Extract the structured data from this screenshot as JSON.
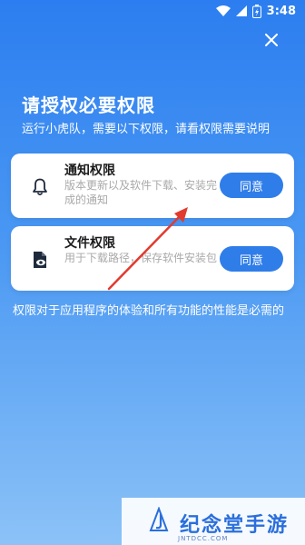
{
  "status_bar": {
    "time": "3:48"
  },
  "header": {
    "title": "请授权必要权限",
    "subtitle": "运行小虎队，需要以下权限，请看权限需要说明"
  },
  "permissions": [
    {
      "icon": "bell-icon",
      "title": "通知权限",
      "description": "版本更新以及软件下载、安装完成的通知",
      "button": "同意"
    },
    {
      "icon": "file-view-icon",
      "title": "文件权限",
      "description": "用于下载路径，保存软件安装包",
      "button": "同意"
    }
  ],
  "footer_note": "权限对于应用程序的体验和所有功能的性能是必需的",
  "watermark": {
    "text": "纪念堂手游",
    "url": "JNTDCC.COM"
  },
  "colors": {
    "accent": "#2f7de9",
    "background_top": "#2c7ef0",
    "background_bottom": "#8cc2f7",
    "arrow": "#e23b2e"
  }
}
